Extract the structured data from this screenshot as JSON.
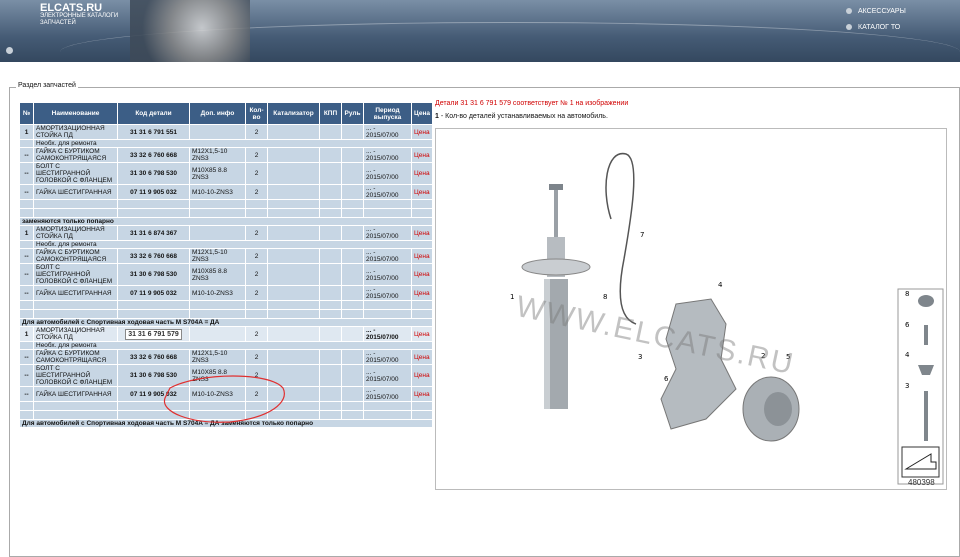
{
  "header": {
    "logo": "ELCATS.RU",
    "subtitle": "ЭЛЕКТРОННЫЕ КАТАЛОГИ ЗАПЧАСТЕЙ",
    "links": [
      "АКСЕССУАРЫ",
      "КАТАЛОГ ТО"
    ]
  },
  "section_title": "Раздел запчастей",
  "table": {
    "columns": [
      "№",
      "Наименование",
      "Код детали",
      "Доп. инфо",
      "Кол-во",
      "Катализатор",
      "КПП",
      "Руль",
      "Период выпуска",
      "Цена"
    ],
    "price_label": "Цена",
    "group1": [
      {
        "num": "1",
        "name": "АМОРТИЗАЦИОННАЯ СТОЙКА ПД",
        "code": "31 31 6 791 551",
        "info": "",
        "qty": "2",
        "period": "... - 2015/07/00"
      },
      {
        "note": "Необх. для ремонта"
      },
      {
        "num": "--",
        "name": "ГАЙКА С БУРТИКОМ САМОКОНТРЯЩАЯСЯ",
        "code": "33 32 6 760 668",
        "info": "M12X1,5-10 ZNS3",
        "qty": "2",
        "period": "... - 2015/07/00"
      },
      {
        "num": "--",
        "name": "БОЛТ С ШЕСТИГРАННОЙ ГОЛОВКОЙ С ФЛАНЦЕМ",
        "code": "31 30 6 798 530",
        "info": "M10X85 8.8 ZNS3",
        "qty": "2",
        "period": "... - 2015/07/00"
      },
      {
        "num": "--",
        "name": "ГАЙКА ШЕСТИГРАННАЯ",
        "code": "07 11 9 905 032",
        "info": "M10-10-ZNS3",
        "qty": "2",
        "period": "... - 2015/07/00"
      }
    ],
    "group2_title": "заменяются только попарно",
    "group2": [
      {
        "num": "1",
        "name": "АМОРТИЗАЦИОННАЯ СТОЙКА ПД",
        "code": "31 31 6 874 367",
        "info": "",
        "qty": "2",
        "period": "... - 2015/07/00"
      },
      {
        "note": "Необх. для ремонта"
      },
      {
        "num": "--",
        "name": "ГАЙКА С БУРТИКОМ САМОКОНТРЯЩАЯСЯ",
        "code": "33 32 6 760 668",
        "info": "M12X1,5-10 ZNS3",
        "qty": "2",
        "period": "... - 2015/07/00"
      },
      {
        "num": "--",
        "name": "БОЛТ С ШЕСТИГРАННОЙ ГОЛОВКОЙ С ФЛАНЦЕМ",
        "code": "31 30 6 798 530",
        "info": "M10X85 8.8 ZNS3",
        "qty": "2",
        "period": "... - 2015/07/00"
      },
      {
        "num": "--",
        "name": "ГАЙКА ШЕСТИГРАННАЯ",
        "code": "07 11 9 905 032",
        "info": "M10-10-ZNS3",
        "qty": "2",
        "period": "... - 2015/07/00"
      }
    ],
    "group3_title": "Для автомобилей с Спортивная ходовая часть M S704A = ДА",
    "group3": [
      {
        "num": "1",
        "name": "АМОРТИЗАЦИОННАЯ СТОЙКА ПД",
        "code": "31 31 6 791 579",
        "info": "",
        "qty": "2",
        "period": "... - 2015/07/00"
      },
      {
        "note": "Необх. для ремонта"
      },
      {
        "num": "--",
        "name": "ГАЙКА С БУРТИКОМ САМОКОНТРЯЩАЯСЯ",
        "code": "33 32 6 760 668",
        "info": "M12X1,5-10 ZNS3",
        "qty": "2",
        "period": "... - 2015/07/00"
      },
      {
        "num": "--",
        "name": "БОЛТ С ШЕСТИГРАННОЙ ГОЛОВКОЙ С ФЛАНЦЕМ",
        "code": "31 30 6 798 530",
        "info": "M10X85 8.8 ZNS3",
        "qty": "2",
        "period": "... - 2015/07/00"
      },
      {
        "num": "--",
        "name": "ГАЙКА ШЕСТИГРАННАЯ",
        "code": "07 11 9 905 032",
        "info": "M10-10-ZNS3",
        "qty": "2",
        "period": "... - 2015/07/00"
      }
    ],
    "group4_title": "Для автомобилей с Спортивная ходовая часть M S704A = ДА заменяются только попарно"
  },
  "info": {
    "match_line": "Детали 31 31 6 791 579 соответствует № 1 на изображении",
    "note_num": "1",
    "note_text": " - Кол-во деталей устанавливаемых на автомобиль."
  },
  "diagram": {
    "callouts": [
      "1",
      "2",
      "3",
      "4",
      "5",
      "6",
      "7",
      "8"
    ],
    "side_labels": [
      "8",
      "6",
      "4",
      "3"
    ],
    "number": "480398",
    "watermark": "WWW.ELCATS.RU"
  }
}
